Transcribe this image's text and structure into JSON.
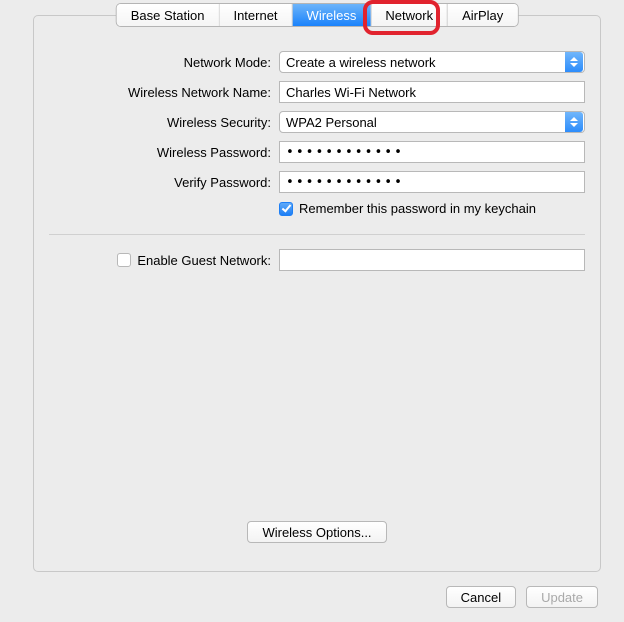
{
  "tabs": {
    "base_station": "Base Station",
    "internet": "Internet",
    "wireless": "Wireless",
    "network": "Network",
    "airplay": "AirPlay"
  },
  "labels": {
    "network_mode": "Network Mode:",
    "wireless_network_name": "Wireless Network Name:",
    "wireless_security": "Wireless Security:",
    "wireless_password": "Wireless Password:",
    "verify_password": "Verify Password:",
    "remember_keychain": "Remember this password in my keychain",
    "enable_guest_network": "Enable Guest Network:"
  },
  "values": {
    "network_mode": "Create a wireless network",
    "wireless_network_name": "Charles Wi-Fi Network",
    "wireless_security": "WPA2 Personal",
    "wireless_password": "••••••••••••",
    "verify_password": "••••••••••••",
    "remember_keychain_checked": true,
    "enable_guest_checked": false,
    "guest_network_name": ""
  },
  "buttons": {
    "wireless_options": "Wireless Options...",
    "cancel": "Cancel",
    "update": "Update"
  }
}
